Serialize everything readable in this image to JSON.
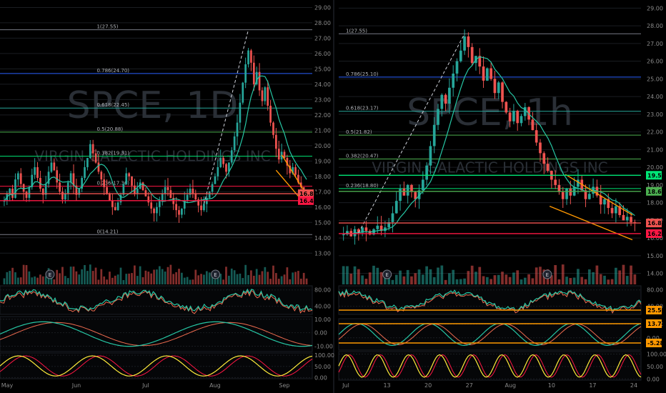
{
  "colors": {
    "bg": "#000000",
    "up": "#26a69a",
    "down": "#ef5350",
    "grid": "#1a1d22",
    "blue": "#2962ff",
    "teal": "#26a69a",
    "green": "#4caf50",
    "lime": "#00e676",
    "red": "#ff1744",
    "orange": "#ff9800",
    "gray": "#787b86",
    "yellow": "#ffeb3b",
    "ma": "#26c6a4",
    "ma2": "#ef6c50"
  },
  "chart_data": [
    {
      "type": "candlestick",
      "watermark": {
        "symbol": "SPCE, 1D",
        "name": "VIRGIN GALACTIC HOLDINGS INC"
      },
      "price_ticks": [
        "29.00",
        "28.00",
        "27.00",
        "26.00",
        "25.00",
        "24.00",
        "23.00",
        "22.00",
        "21.00",
        "20.00",
        "19.00",
        "18.00",
        "17.00",
        "16.00",
        "15.00",
        "14.00",
        "13.00"
      ],
      "time_ticks": [
        "May",
        "Jun",
        "Jul",
        "Aug",
        "Sep"
      ],
      "ylim": [
        12.5,
        29.3
      ],
      "fib_levels": [
        {
          "label": "1(27.55)",
          "value": 27.55,
          "color": "gray"
        },
        {
          "label": "0.786(24.70)",
          "value": 24.7,
          "color": "blue"
        },
        {
          "label": "0.618(22.45)",
          "value": 22.45,
          "color": "teal"
        },
        {
          "label": "0.5(20.88)",
          "value": 20.88,
          "color": "green"
        },
        {
          "label": "0.382(19.31)",
          "value": 19.31,
          "color": "lime"
        },
        {
          "label": "0.236(17.36)",
          "value": 17.36,
          "color": "red"
        },
        {
          "label": "0(14.21)",
          "value": 14.21,
          "color": "gray"
        }
      ],
      "price_tags": [
        {
          "text": "16.87",
          "value": 16.87,
          "color": "#ef5350"
        },
        {
          "text": "16.42",
          "value": 16.42,
          "color": "#ff1744"
        }
      ],
      "closes": [
        16.4,
        16.9,
        17.2,
        16.6,
        17.8,
        18.2,
        17.5,
        17.0,
        16.6,
        17.3,
        18.1,
        18.6,
        17.9,
        17.2,
        16.8,
        17.5,
        18.3,
        18.9,
        18.4,
        17.6,
        17.0,
        16.5,
        16.9,
        17.6,
        18.2,
        17.4,
        16.8,
        17.2,
        17.9,
        18.6,
        19.2,
        20.1,
        19.5,
        18.9,
        18.3,
        17.8,
        17.3,
        16.9,
        16.4,
        16.0,
        15.8,
        16.3,
        16.8,
        17.5,
        18.2,
        18.0,
        17.4,
        16.9,
        17.2,
        17.6,
        17.1,
        16.7,
        16.3,
        15.9,
        15.6,
        16.0,
        16.4,
        16.9,
        17.3,
        17.1,
        16.6,
        16.2,
        15.8,
        15.5,
        15.9,
        16.4,
        16.8,
        17.2,
        16.9,
        16.5,
        16.1,
        15.8,
        16.2,
        16.6,
        17.0,
        17.5,
        18.0,
        18.6,
        19.2,
        18.8,
        18.3,
        18.9,
        19.7,
        20.6,
        21.5,
        22.8,
        24.1,
        25.3,
        26.2,
        25.4,
        24.0,
        24.8,
        23.6,
        22.9,
        23.8,
        22.6,
        21.5,
        20.7,
        19.8,
        19.1,
        19.6,
        19.2,
        18.7,
        18.2,
        18.6,
        18.1,
        17.6,
        17.3,
        17.0,
        16.87
      ],
      "volume_ticks": [],
      "sub_panels": [
        {
          "name": "rsi",
          "ticks": [
            "80.00",
            "40.00"
          ],
          "range": [
            20,
            90
          ]
        },
        {
          "name": "macd",
          "ticks": [
            "10.00",
            "0.00",
            "-10.00"
          ],
          "range": [
            -14,
            12
          ]
        },
        {
          "name": "stoch",
          "ticks": [
            "100.00",
            "50.00",
            "0.00"
          ],
          "range": [
            -5,
            110
          ]
        }
      ]
    },
    {
      "type": "candlestick",
      "watermark": {
        "symbol": "SPCE, 1h",
        "name": "VIRGIN GALACTIC HOLDINGS INC"
      },
      "price_ticks": [
        "29.00",
        "28.00",
        "27.00",
        "26.00",
        "25.00",
        "24.00",
        "23.00",
        "22.00",
        "21.00",
        "20.00",
        "19.00",
        "18.00",
        "17.00",
        "16.00",
        "15.00",
        "14.00"
      ],
      "time_ticks": [
        "Jul",
        "13",
        "20",
        "27",
        "Aug",
        "10",
        "17",
        "24"
      ],
      "ylim": [
        13.5,
        29.3
      ],
      "fib_levels": [
        {
          "label": "1(27.55)",
          "value": 27.55,
          "color": "gray"
        },
        {
          "label": "0.786(25.10)",
          "value": 25.1,
          "color": "blue"
        },
        {
          "label": "0.618(23.17)",
          "value": 23.17,
          "color": "teal"
        },
        {
          "label": "0.5(21.82)",
          "value": 21.82,
          "color": "green"
        },
        {
          "label": "0.382(20.47)",
          "value": 20.47,
          "color": "green"
        },
        {
          "label": "0.236(18.80)",
          "value": 18.8,
          "color": "lime"
        }
      ],
      "price_tags": [
        {
          "text": "19.55",
          "value": 19.55,
          "color": "#00e676"
        },
        {
          "text": "18.64",
          "value": 18.64,
          "color": "#4caf50"
        },
        {
          "text": "16.85",
          "value": 16.85,
          "color": "#ef5350"
        },
        {
          "text": "16.25",
          "value": 16.25,
          "color": "#ff1744"
        }
      ],
      "closes": [
        16.2,
        16.4,
        16.1,
        16.5,
        16.3,
        16.6,
        16.4,
        16.2,
        16.5,
        16.7,
        16.4,
        16.6,
        16.9,
        17.4,
        18.1,
        18.8,
        18.4,
        19.0,
        18.6,
        18.2,
        18.7,
        19.3,
        20.1,
        21.2,
        22.4,
        23.3,
        24.1,
        23.6,
        24.5,
        25.3,
        26.0,
        26.6,
        27.4,
        26.8,
        25.9,
        26.3,
        25.7,
        24.9,
        25.6,
        25.0,
        24.2,
        24.8,
        23.7,
        23.1,
        22.6,
        23.2,
        22.5,
        22.9,
        23.4,
        22.7,
        22.1,
        21.4,
        20.8,
        20.2,
        19.8,
        19.3,
        19.0,
        18.6,
        18.2,
        18.8,
        18.4,
        18.9,
        19.3,
        18.7,
        18.2,
        18.5,
        18.9,
        18.4,
        17.9,
        18.2,
        17.7,
        17.4,
        17.8,
        17.3,
        17.0,
        17.2,
        16.9,
        16.85
      ],
      "sub_panels": [
        {
          "name": "rsi",
          "ticks": [
            "80.00",
            "40.00"
          ],
          "range": [
            20,
            90
          ],
          "tag": "25.56"
        },
        {
          "name": "macd",
          "ticks": [
            "10.00",
            "0.00"
          ],
          "range": [
            -9,
            14
          ],
          "tags": [
            "13.74",
            "-5.28"
          ]
        },
        {
          "name": "stoch",
          "ticks": [
            "100.00",
            "50.00",
            "0.00"
          ],
          "range": [
            -5,
            110
          ]
        }
      ]
    }
  ]
}
